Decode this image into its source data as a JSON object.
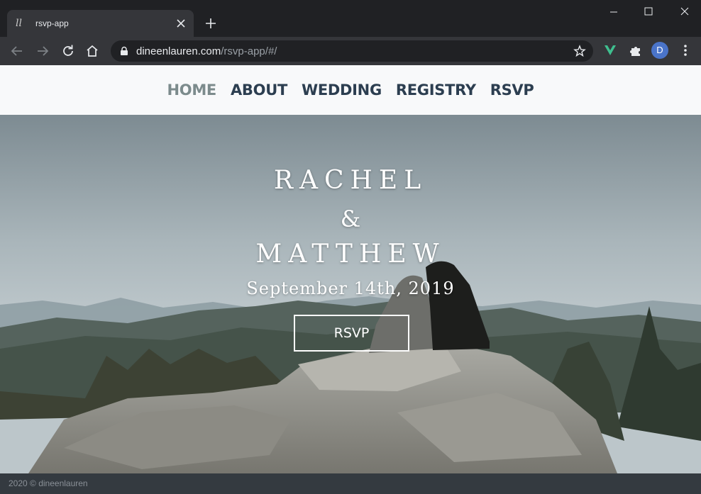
{
  "browser": {
    "tab_title": "rsvp-app",
    "url_host": "dineenlauren.com",
    "url_path": "/rsvp-app/#/",
    "avatar_letter": "D",
    "accent_extension_color": "#3fbf8f",
    "avatar_color": "#4a74c9"
  },
  "nav": {
    "items": [
      {
        "label": "HOME",
        "active": true
      },
      {
        "label": "ABOUT",
        "active": false
      },
      {
        "label": "WEDDING",
        "active": false
      },
      {
        "label": "REGISTRY",
        "active": false
      },
      {
        "label": "RSVP",
        "active": false
      }
    ]
  },
  "hero": {
    "name_one": "RACHEL",
    "ampersand": "&",
    "name_two": "MATTHEW",
    "date": "September 14th, 2019",
    "button_label": "RSVP"
  },
  "footer": {
    "text": "2020 © dineenlauren"
  }
}
